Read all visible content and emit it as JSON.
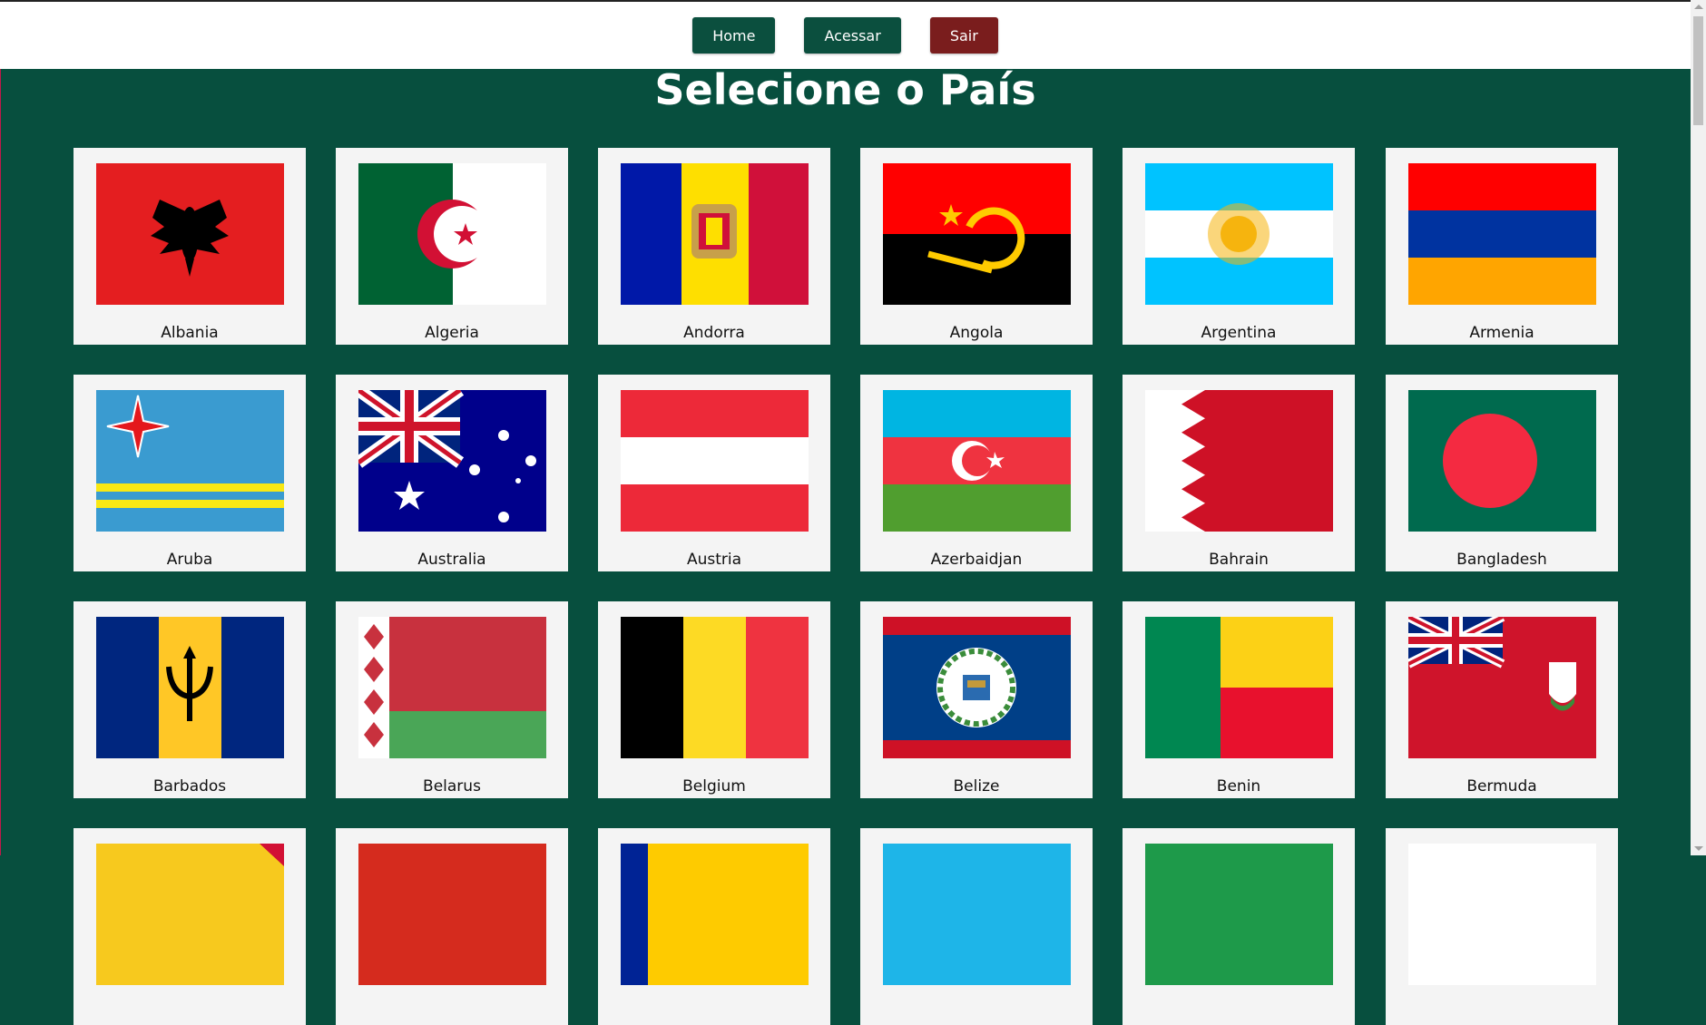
{
  "nav": {
    "home_label": "Home",
    "login_label": "Acessar",
    "logout_label": "Sair"
  },
  "page_title": "Selecione o País",
  "colors": {
    "background": "#074f3e",
    "nav_button_green": "#0b4f3e",
    "nav_button_red": "#7a1d1d",
    "card_background": "#f4f4f4"
  },
  "countries": [
    {
      "name": "Albania"
    },
    {
      "name": "Algeria"
    },
    {
      "name": "Andorra"
    },
    {
      "name": "Angola"
    },
    {
      "name": "Argentina"
    },
    {
      "name": "Armenia"
    },
    {
      "name": "Aruba"
    },
    {
      "name": "Australia"
    },
    {
      "name": "Austria"
    },
    {
      "name": "Azerbaidjan"
    },
    {
      "name": "Bahrain"
    },
    {
      "name": "Bangladesh"
    },
    {
      "name": "Barbados"
    },
    {
      "name": "Belarus"
    },
    {
      "name": "Belgium"
    },
    {
      "name": "Belize"
    },
    {
      "name": "Benin"
    },
    {
      "name": "Bermuda"
    }
  ]
}
